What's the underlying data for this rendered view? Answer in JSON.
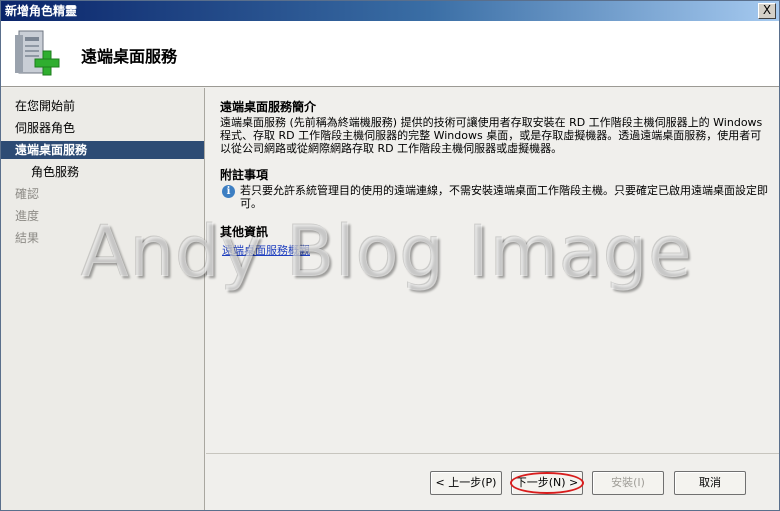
{
  "window": {
    "title": "新增角色精靈",
    "close_glyph": "X"
  },
  "header": {
    "title": "遠端桌面服務",
    "icon": "server-add-icon"
  },
  "sidebar": {
    "items": [
      {
        "label": "在您開始前",
        "state": "normal"
      },
      {
        "label": "伺服器角色",
        "state": "normal"
      },
      {
        "label": "遠端桌面服務",
        "state": "active"
      },
      {
        "label": "角色服務",
        "state": "sub"
      },
      {
        "label": "確認",
        "state": "disabled"
      },
      {
        "label": "進度",
        "state": "disabled"
      },
      {
        "label": "結果",
        "state": "disabled"
      }
    ]
  },
  "content": {
    "intro_title": "遠端桌面服務簡介",
    "intro_text": "遠端桌面服務 (先前稱為終端機服務) 提供的技術可讓使用者存取安裝在 RD 工作階段主機伺服器上的 Windows 程式、存取 RD 工作階段主機伺服器的完整 Windows 桌面，或是存取虛擬機器。透過遠端桌面服務，使用者可以從公司網路或從網際網路存取 RD 工作階段主機伺服器或虛擬機器。",
    "notes_title": "附註事項",
    "note_icon": "info-icon",
    "note_text": "若只要允許系統管理目的使用的遠端連線，不需安裝遠端桌面工作階段主機。只要確定已啟用遠端桌面設定即可。",
    "more_title": "其他資訊",
    "link_text": "遠端桌面服務概觀"
  },
  "watermark": "Andy Blog Image",
  "footer": {
    "prev": "< 上一步(P)",
    "next": "下一步(N) >",
    "install": "安裝(I)",
    "cancel": "取消"
  },
  "colors": {
    "active_nav": "#2d4b74",
    "highlight": "#d81c1c",
    "link": "#1f3fbf"
  }
}
